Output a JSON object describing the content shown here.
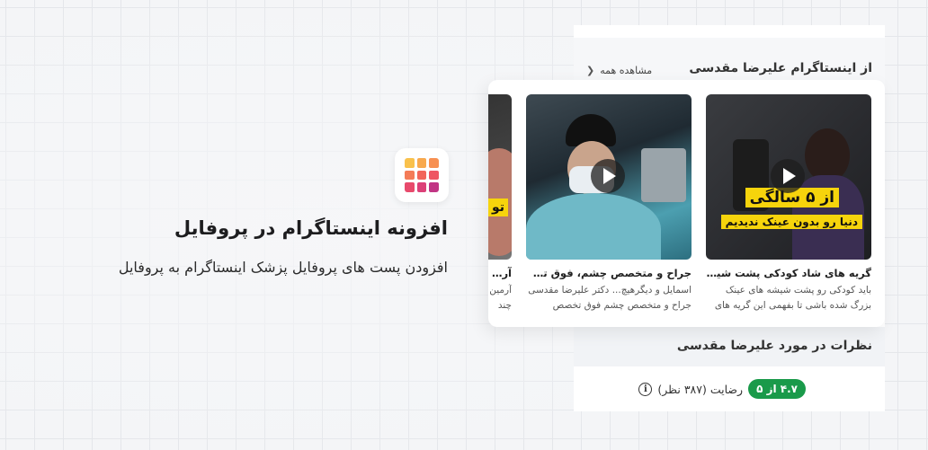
{
  "feature": {
    "icon": "instagram-grid-icon",
    "title": "افزونه اینستاگرام در پروفایل",
    "subtitle": "افزودن پست های پروفایل پزشک اینستاگرام به پروفایل"
  },
  "instagram_section": {
    "title": "از اینستاگرام علیرضا مقدسی",
    "see_all": "مشاهده همه",
    "posts": [
      {
        "title": "گریه های شاد کودکی پشت شیشهای...",
        "desc": "باید کودکی رو پشت شیشه های عینک بزرگ شده باشی تا بفهمی این گریه های ...",
        "overlay_line1": "از ۵ سالگی",
        "overlay_line2": "دنیا رو بدون عینک ندیدیم"
      },
      {
        "title": "جراح و متخصص چشم، فوق تخصـ...",
        "desc": "اسمایل و دیگرهیچ... دکتر علیرضا مقدسی جراح و متخصص چشم فوق تخصص قرنیـ..."
      },
      {
        "title": "آرمین",
        "desc": "آرمین چند س",
        "overlay_line1": "تو"
      }
    ]
  },
  "reviews_section": {
    "title": "نظرات در مورد علیرضا مقدسی",
    "rating_badge": "۴.۷ از ۵",
    "rating_text": "رضایت (۳۸۷ نظر)",
    "info_symbol": "i"
  },
  "colors": {
    "rating_green": "#1a9a4a",
    "overlay_yellow": "#f6d40c",
    "icon_gradient": [
      "#f9c14c",
      "#f2545b",
      "#c13584"
    ]
  }
}
